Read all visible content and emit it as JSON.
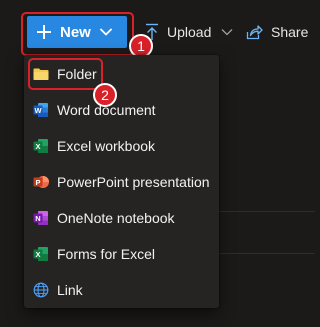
{
  "toolbar": {
    "new_label": "New",
    "upload_label": "Upload",
    "share_label": "Share",
    "accent_color": "#2887e0"
  },
  "annotations": {
    "step1": "1",
    "step2": "2",
    "highlight_color": "#d9212a"
  },
  "menu": {
    "items": [
      {
        "label": "Folder",
        "icon": "folder-icon",
        "color": "#f2c94c"
      },
      {
        "label": "Word document",
        "icon": "word-icon",
        "color": "#2b579a"
      },
      {
        "label": "Excel workbook",
        "icon": "excel-icon",
        "color": "#217346"
      },
      {
        "label": "PowerPoint presentation",
        "icon": "powerpoint-icon",
        "color": "#d24726"
      },
      {
        "label": "OneNote notebook",
        "icon": "onenote-icon",
        "color": "#7719aa"
      },
      {
        "label": "Forms for Excel",
        "icon": "forms-for-excel-icon",
        "color": "#217346"
      },
      {
        "label": "Link",
        "icon": "globe-icon",
        "color": "#4a9ff5"
      }
    ]
  }
}
